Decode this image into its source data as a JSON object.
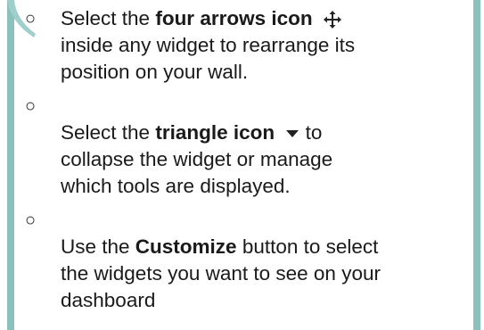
{
  "bullet_char": "○",
  "items": [
    {
      "pre": "Select the ",
      "bold": "four arrows icon",
      "icon": "four-arrows-icon",
      "line2": "inside any widget to rearrange its",
      "line3": "position on your wall."
    },
    {
      "pre": "Select the ",
      "bold": "triangle icon",
      "icon": "triangle-down-icon",
      "post": " to",
      "line2": "collapse the widget or manage",
      "line3": "which tools are displayed."
    },
    {
      "pre": "Use the ",
      "bold": "Customize",
      "post": " button to select",
      "line2": "the widgets you want to see on your",
      "line3": "dashboard"
    }
  ],
  "colors": {
    "border": "#8cc0bd",
    "icon": "#222222"
  }
}
